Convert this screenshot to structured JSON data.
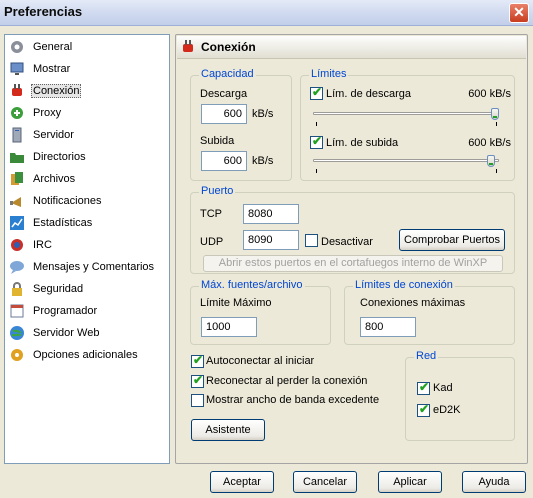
{
  "window": {
    "title": "Preferencias",
    "close_glyph": "✕"
  },
  "sidebar": {
    "items": [
      {
        "label": "General",
        "icon": "gear-icon"
      },
      {
        "label": "Mostrar",
        "icon": "monitor-icon"
      },
      {
        "label": "Conexión",
        "icon": "plug-icon"
      },
      {
        "label": "Proxy",
        "icon": "proxy-icon"
      },
      {
        "label": "Servidor",
        "icon": "server-icon"
      },
      {
        "label": "Directorios",
        "icon": "folder-icon"
      },
      {
        "label": "Archivos",
        "icon": "files-icon"
      },
      {
        "label": "Notificaciones",
        "icon": "notification-icon"
      },
      {
        "label": "Estadísticas",
        "icon": "stats-icon"
      },
      {
        "label": "IRC",
        "icon": "irc-icon"
      },
      {
        "label": "Mensajes y Comentarios",
        "icon": "messages-icon"
      },
      {
        "label": "Seguridad",
        "icon": "lock-icon"
      },
      {
        "label": "Programador",
        "icon": "calendar-icon"
      },
      {
        "label": "Servidor Web",
        "icon": "globe-icon"
      },
      {
        "label": "Opciones adicionales",
        "icon": "options-icon"
      }
    ],
    "selected_index": 2
  },
  "header": {
    "title": "Conexión",
    "icon": "plug-icon"
  },
  "capacidad": {
    "label": "Capacidad",
    "download_label": "Descarga",
    "download_value": "600",
    "download_unit": "kB/s",
    "upload_label": "Subida",
    "upload_value": "600",
    "upload_unit": "kB/s"
  },
  "limites": {
    "label": "Límites",
    "download_check_label": "Lím. de descarga",
    "download_checked": true,
    "download_value_text": "600 kB/s",
    "download_slider_fraction": 1.0,
    "upload_check_label": "Lím. de subida",
    "upload_checked": true,
    "upload_value_text": "600 kB/s",
    "upload_slider_fraction": 1.0
  },
  "puerto": {
    "label": "Puerto",
    "tcp_label": "TCP",
    "tcp_value": "8080",
    "udp_label": "UDP",
    "udp_value": "8090",
    "disable_label": "Desactivar",
    "disable_checked": false,
    "check_ports_button": "Comprobar Puertos",
    "firewall_button": "Abrir estos puertos en el cortafuegos interno de WinXP"
  },
  "max_fuentes": {
    "label": "Máx. fuentes/archivo",
    "limit_label": "Límite Máximo",
    "limit_value": "1000"
  },
  "limites_conexion": {
    "label": "Límites de conexión",
    "max_label": "Conexiones máximas",
    "max_value": "800"
  },
  "options": {
    "autoconnect_label": "Autoconectar al iniciar",
    "autoconnect_checked": true,
    "reconnect_label": "Reconectar al perder la conexión",
    "reconnect_checked": true,
    "overhead_label": "Mostrar ancho de banda excedente",
    "overhead_checked": false
  },
  "red": {
    "label": "Red",
    "kad_label": "Kad",
    "kad_checked": true,
    "ed2k_label": "eD2K",
    "ed2k_checked": true
  },
  "wizard_button": "Asistente",
  "footer": {
    "ok": "Aceptar",
    "cancel": "Cancelar",
    "apply": "Aplicar",
    "help": "Ayuda"
  },
  "check_glyph": "✔",
  "colors": {
    "accent_blue": "#0046d5",
    "check_green": "#21a121"
  }
}
